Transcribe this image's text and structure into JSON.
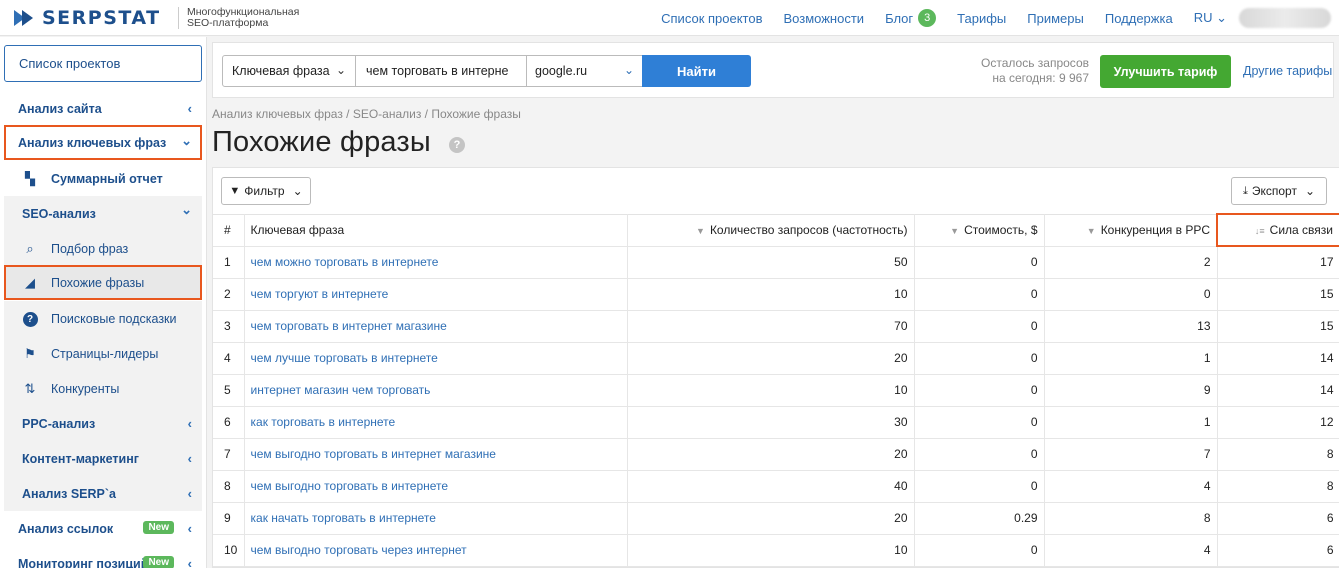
{
  "brand": {
    "name": "SERPSTAT",
    "tagline_line1": "Многофункциональная",
    "tagline_line2": "SEO-платформа",
    "color": "#1d4f8c"
  },
  "topnav": {
    "projects": "Список проектов",
    "features": "Возможности",
    "blog": "Блог",
    "blog_count": "3",
    "pricing": "Тарифы",
    "examples": "Примеры",
    "support": "Поддержка",
    "lang": "RU"
  },
  "sidebar": {
    "projects_button": "Список проектов",
    "items": [
      {
        "label": "Анализ сайта",
        "chevron": "‹"
      },
      {
        "label": "Анализ ключевых фраз",
        "chevron": "⌄"
      },
      {
        "label": "Суммарный отчет",
        "icon": "summary-icon"
      },
      {
        "label": "SEO-анализ",
        "chevron": "⌄"
      },
      {
        "label": "Подбор фраз",
        "icon": "search-icon"
      },
      {
        "label": "Похожие фразы",
        "icon": "chart-icon"
      },
      {
        "label": "Поисковые подсказки",
        "icon": "question-icon"
      },
      {
        "label": "Страницы-лидеры",
        "icon": "flag-icon"
      },
      {
        "label": "Конкуренты",
        "icon": "arrows-icon"
      },
      {
        "label": "PPC-анализ",
        "chevron": "‹"
      },
      {
        "label": "Контент-маркетинг",
        "chevron": "‹"
      },
      {
        "label": "Анализ SERP`а",
        "chevron": "‹"
      },
      {
        "label": "Анализ ссылок",
        "chevron": "‹",
        "badge": "New"
      },
      {
        "label": "Мониторинг позиций",
        "chevron": "‹",
        "badge": "New"
      }
    ]
  },
  "search": {
    "type_label": "Ключевая фраза",
    "query_value": "чем торговать в интерне",
    "engine_value": "google.ru",
    "find_label": "Найти",
    "remaining_line1": "Осталось запросов",
    "remaining_line2": "на сегодня: 9 967",
    "upgrade_label": "Улучшить тариф",
    "other_plans": "Другие тарифы"
  },
  "page": {
    "breadcrumb": "Анализ ключевых фраз / SEO-анализ / Похожие фразы",
    "title": "Похожие фразы",
    "help": "?"
  },
  "toolbar": {
    "filter_label": "Фильтр",
    "export_label": "Экспорт"
  },
  "table": {
    "headers": {
      "idx": "#",
      "keyword": "Ключевая фраза",
      "volume": "Количество запросов (частотность)",
      "cost": "Стоимость, $",
      "competition": "Конкуренция в PPC",
      "strength": "Сила связи"
    },
    "rows": [
      {
        "idx": "1",
        "keyword": "чем можно торговать в интернете",
        "volume": "50",
        "cost": "0",
        "competition": "2",
        "strength": "17"
      },
      {
        "idx": "2",
        "keyword": "чем торгуют в интернете",
        "volume": "10",
        "cost": "0",
        "competition": "0",
        "strength": "15"
      },
      {
        "idx": "3",
        "keyword": "чем торговать в интернет магазине",
        "volume": "70",
        "cost": "0",
        "competition": "13",
        "strength": "15"
      },
      {
        "idx": "4",
        "keyword": "чем лучше торговать в интернете",
        "volume": "20",
        "cost": "0",
        "competition": "1",
        "strength": "14"
      },
      {
        "idx": "5",
        "keyword": "интернет магазин чем торговать",
        "volume": "10",
        "cost": "0",
        "competition": "9",
        "strength": "14"
      },
      {
        "idx": "6",
        "keyword": "как торговать в интернете",
        "volume": "30",
        "cost": "0",
        "competition": "1",
        "strength": "12"
      },
      {
        "idx": "7",
        "keyword": "чем выгодно торговать в интернет магазине",
        "volume": "20",
        "cost": "0",
        "competition": "7",
        "strength": "8"
      },
      {
        "idx": "8",
        "keyword": "чем выгодно торговать в интернете",
        "volume": "40",
        "cost": "0",
        "competition": "4",
        "strength": "8"
      },
      {
        "idx": "9",
        "keyword": "как начать торговать в интернете",
        "volume": "20",
        "cost": "0.29",
        "competition": "8",
        "strength": "6"
      },
      {
        "idx": "10",
        "keyword": "чем выгодно торговать через интернет",
        "volume": "10",
        "cost": "0",
        "competition": "4",
        "strength": "6"
      }
    ]
  },
  "colors": {
    "accent": "#2f6fb5",
    "highlight": "#e8571e",
    "green": "#44a832",
    "find": "#2f7fd6"
  }
}
